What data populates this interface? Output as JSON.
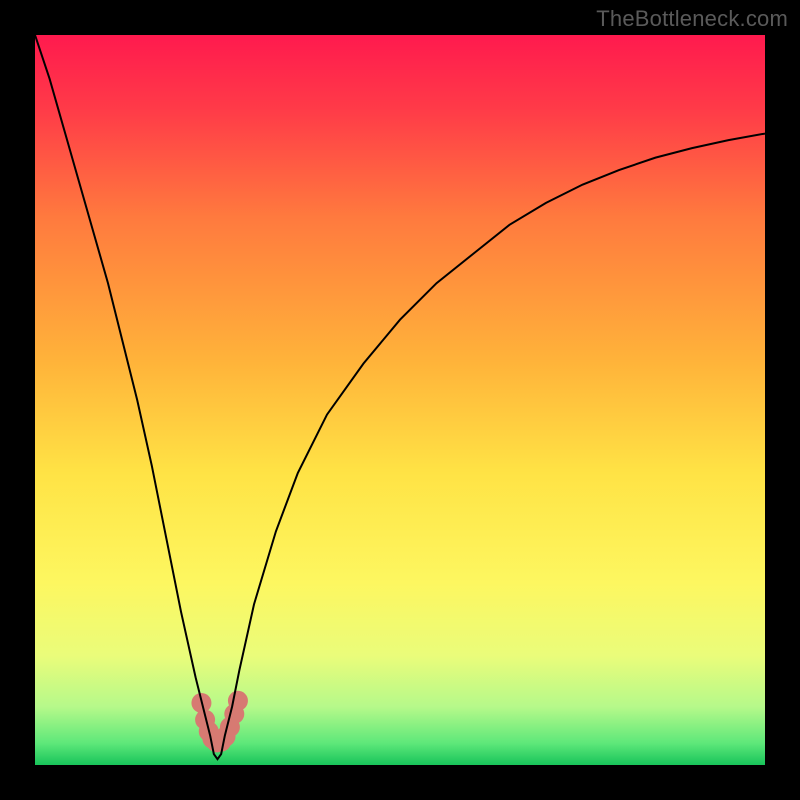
{
  "watermark": "TheBottleneck.com",
  "chart_data": {
    "type": "line",
    "title": "",
    "xlabel": "",
    "ylabel": "",
    "xlim": [
      0,
      100
    ],
    "ylim": [
      0,
      100
    ],
    "grid": false,
    "legend": false,
    "background_gradient": {
      "stops": [
        {
          "pct": 0,
          "color": "#ff1a4e"
        },
        {
          "pct": 10,
          "color": "#ff3a48"
        },
        {
          "pct": 25,
          "color": "#ff7a3e"
        },
        {
          "pct": 45,
          "color": "#ffb43a"
        },
        {
          "pct": 60,
          "color": "#ffe345"
        },
        {
          "pct": 75,
          "color": "#fdf760"
        },
        {
          "pct": 85,
          "color": "#eafc7a"
        },
        {
          "pct": 92,
          "color": "#b6f98a"
        },
        {
          "pct": 97,
          "color": "#5ee87a"
        },
        {
          "pct": 100,
          "color": "#18c45a"
        }
      ]
    },
    "series": [
      {
        "name": "bottleneck-curve",
        "color": "#000000",
        "width": 2,
        "x": [
          0,
          2,
          4,
          6,
          8,
          10,
          12,
          14,
          16,
          18,
          20,
          22,
          24,
          24.5,
          25,
          25.5,
          26,
          27,
          28,
          30,
          33,
          36,
          40,
          45,
          50,
          55,
          60,
          65,
          70,
          75,
          80,
          85,
          90,
          95,
          100
        ],
        "values": [
          100,
          94,
          87,
          80,
          73,
          66,
          58,
          50,
          41,
          31,
          21,
          12,
          4,
          1.5,
          0.8,
          1.5,
          4,
          8,
          13,
          22,
          32,
          40,
          48,
          55,
          61,
          66,
          70,
          74,
          77,
          79.5,
          81.5,
          83.2,
          84.5,
          85.6,
          86.5
        ]
      }
    ],
    "highlight": {
      "name": "minimum-marker",
      "color": "#d77a72",
      "points": [
        {
          "x": 22.8,
          "y": 8.5
        },
        {
          "x": 23.3,
          "y": 6.2
        },
        {
          "x": 23.8,
          "y": 4.6
        },
        {
          "x": 24.3,
          "y": 3.6
        },
        {
          "x": 24.9,
          "y": 3.1
        },
        {
          "x": 25.5,
          "y": 3.2
        },
        {
          "x": 26.1,
          "y": 3.9
        },
        {
          "x": 26.7,
          "y": 5.2
        },
        {
          "x": 27.3,
          "y": 7.0
        },
        {
          "x": 27.8,
          "y": 8.8
        }
      ],
      "radius": 10
    }
  }
}
